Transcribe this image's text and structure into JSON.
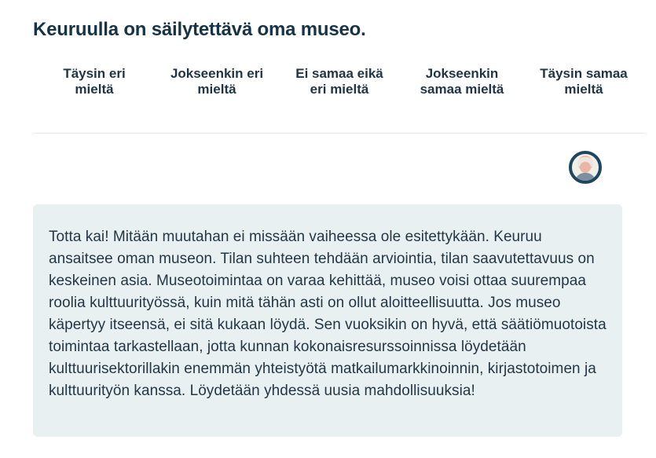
{
  "question": {
    "title": "Keuruulla on säilytettävä oma museo."
  },
  "scale": {
    "options": [
      "Täysin eri\nmieltä",
      "Jokseenkin eri\nmieltä",
      "Ei samaa eikä\neri mieltä",
      "Jokseenkin\nsamaa mieltä",
      "Täysin samaa\nmieltä"
    ]
  },
  "avatar": {
    "icon": "person-avatar-icon"
  },
  "comment": {
    "text": "Totta kai! Mitään muutahan ei missään vaiheessa ole esitettykään. Keuruu ansaitsee oman museon. Tilan suhteen tehdään arviointia, tilan saavutettavuus on keskeinen asia. Museotoimintaa on varaa kehittää, museo voisi ottaa suurempaa roolia kulttuurityössä, kuin mitä tähän asti on ollut aloitteellisuutta. Jos museo käpertyy itseensä, ei sitä kukaan löydä. Sen vuoksikin on hyvä, että säätiömuotoista toimintaa tarkastellaan, jotta kunnan kokonaisresurssoinnissa löydetään kulttuurisektorillakin enemmän yhteistyötä matkailumarkkinoinnin, kirjastotoimen ja kulttuurityön kanssa. Löydetään yhdessä uusia mahdollisuuksia!"
  },
  "colors": {
    "title": "#173447",
    "text": "#243746",
    "comment_background": "#e8f0f1",
    "avatar_border": "#1d4660",
    "divider": "#e5e9ec"
  }
}
